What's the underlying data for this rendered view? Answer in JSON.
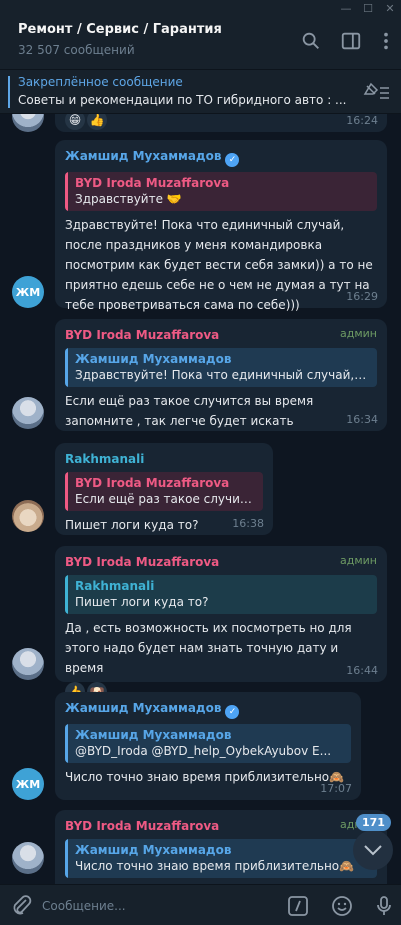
{
  "header": {
    "title": "Ремонт / Сервис / Гарантия",
    "subtitle": "32 507 сообщений"
  },
  "pinned": {
    "label": "Закреплённое сообщение",
    "text": "Советы и рекомендации по ТО гибридного авто :   ..."
  },
  "top_fragment": {
    "time": "16:24"
  },
  "messages": [
    {
      "sender": "Жамшид Мухаммадов",
      "reply_name": "BYD Iroda Muzaffarova",
      "reply_text": "Здравствуйте 🤝",
      "text": "Здравствуйте! Пока что единичный случай, после праздников у меня командировка посмотрим как будет вести себя замки)) а то не приятно едешь себе не о чем не думая а тут на тебе проветриваться сама по себе)))",
      "time": "16:29",
      "avatar": "ЖМ"
    },
    {
      "sender": "BYD Iroda Muzaffarova",
      "role": "админ",
      "reply_name": "Жамшид Мухаммадов",
      "reply_text": "Здравствуйте! Пока что единичный случай, по...",
      "text": "Если ещё раз такое случится вы время запомните , так легче будет искать",
      "time": "16:34"
    },
    {
      "sender": "Rakhmanali",
      "reply_name": "BYD Iroda Muzaffarova",
      "reply_text": "Если ещё раз такое случитс...",
      "text": "Пишет логи куда то?",
      "time": "16:38"
    },
    {
      "sender": "BYD Iroda Muzaffarova",
      "role": "админ",
      "reply_name": "Rakhmanali",
      "reply_text": "Пишет логи куда то?",
      "text": "Да , есть возможность их посмотреть но для этого надо будет нам знать точную дату и время",
      "time": "16:44",
      "reactions": [
        "👍",
        "🐶"
      ]
    },
    {
      "sender": "Жамшид Мухаммадов",
      "reply_name": "Жамшид Мухаммадов",
      "reply_text": "@BYD_Iroda @BYD_help_OybekAyubov   E...",
      "text": "Число точно знаю время приблизительно🙈",
      "time": "17:07",
      "avatar": "ЖМ"
    },
    {
      "sender": "BYD Iroda Muzaffarova",
      "role": "админ",
      "reply_name": "Жамшид Мухаммадов",
      "reply_text": "Число точно знаю время приблизительно🙈"
    }
  ],
  "unread_count": "171",
  "input": {
    "placeholder": "Сообщение..."
  },
  "colors": {
    "background": "#0e1621",
    "bubble": "#182533",
    "accent": "#5ea6e6",
    "admin": "#6d9a63"
  }
}
